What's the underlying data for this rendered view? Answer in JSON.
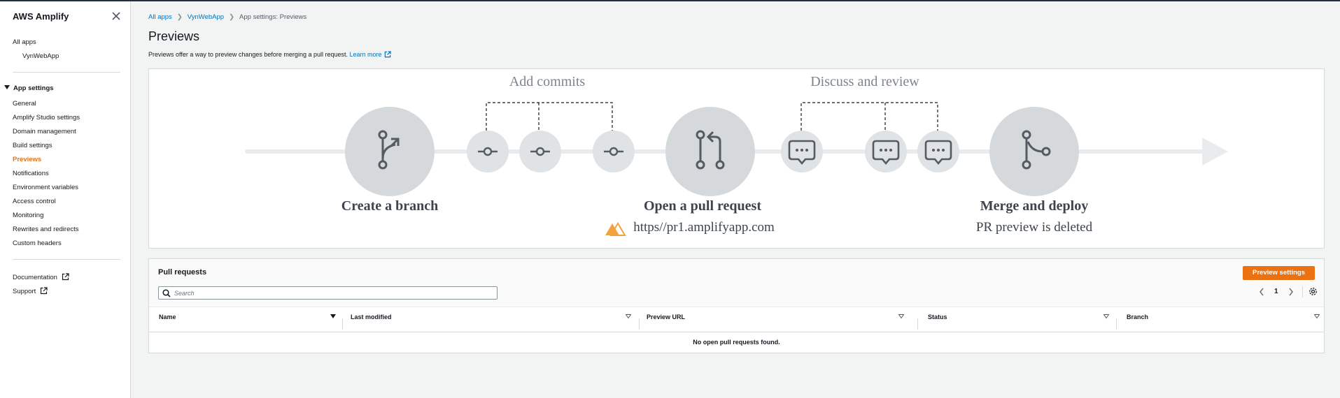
{
  "app": {
    "title": "AWS Amplify"
  },
  "sidebar": {
    "all_apps": "All apps",
    "app_name": "VynWebApp",
    "section": "App settings",
    "items": [
      {
        "label": "General"
      },
      {
        "label": "Amplify Studio settings"
      },
      {
        "label": "Domain management"
      },
      {
        "label": "Build settings"
      },
      {
        "label": "Previews",
        "active": true
      },
      {
        "label": "Notifications"
      },
      {
        "label": "Environment variables"
      },
      {
        "label": "Access control"
      },
      {
        "label": "Monitoring"
      },
      {
        "label": "Rewrites and redirects"
      },
      {
        "label": "Custom headers"
      }
    ],
    "documentation": "Documentation",
    "support": "Support"
  },
  "breadcrumb": {
    "items": [
      "All apps",
      "VynWebApp",
      "App settings: Previews"
    ]
  },
  "page": {
    "title": "Previews",
    "description": "Previews offer a way to preview changes before merging a pull request.",
    "learn_more": "Learn more"
  },
  "diagram": {
    "add_commits": "Add commits",
    "discuss_review": "Discuss and review",
    "create_branch": "Create a branch",
    "open_pr": "Open a pull request",
    "pr_url": "https//pr1.amplifyapp.com",
    "merge_deploy": "Merge and deploy",
    "pr_deleted": "PR preview is deleted"
  },
  "pull_requests": {
    "title": "Pull requests",
    "preview_settings_button": "Preview settings",
    "search_placeholder": "Search",
    "page": "1",
    "columns": [
      "Name",
      "Last modified",
      "Preview URL",
      "Status",
      "Branch"
    ],
    "empty": "No open pull requests found."
  },
  "colors": {
    "accent": "#ec7211",
    "link": "#0073bb",
    "diagram_circle": "#d5d9db",
    "diagram_icon": "#545b64"
  }
}
